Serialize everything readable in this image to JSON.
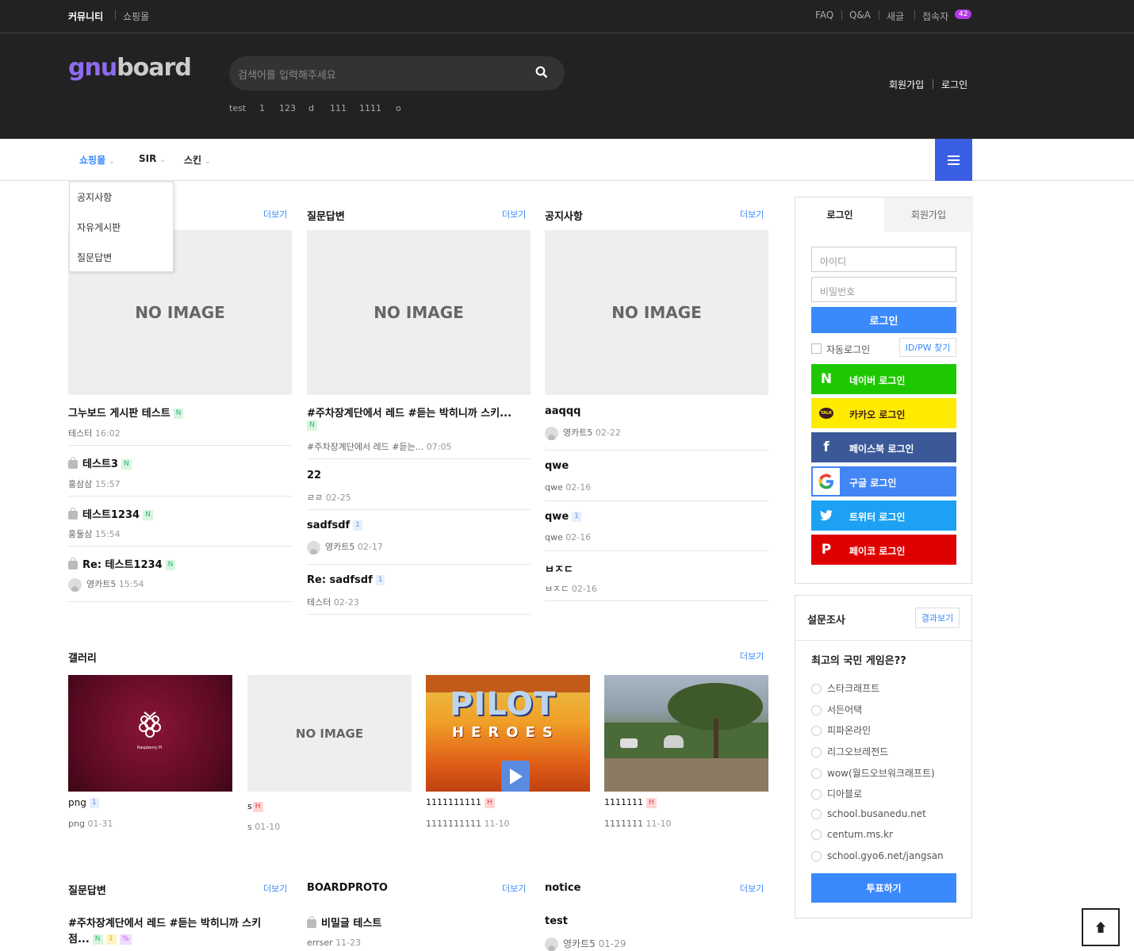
{
  "topbar": {
    "community": "커뮤니티",
    "shop": "쇼핑몰",
    "faq": "FAQ",
    "qa": "Q&A",
    "new_posts": "새글",
    "visitors": "접속자",
    "visitor_count": "42"
  },
  "header": {
    "logo_a": "gnu",
    "logo_b": "board",
    "search_placeholder": "검색어를 입력해주세요",
    "popular": [
      "test",
      "1",
      "123",
      "d",
      "111",
      "1111",
      "o"
    ],
    "join": "회원가입",
    "login": "로그인"
  },
  "nav": {
    "items": [
      "쇼핑몰",
      "SIR",
      "스킨"
    ],
    "dropdown": [
      "공지사항",
      "자유게시판",
      "질문답변"
    ]
  },
  "more": "더보기",
  "col1": {
    "image": "NO IMAGE",
    "posts": [
      {
        "title": "그누보드 게시판 테스트",
        "author": "테스터",
        "date": "16:02"
      },
      {
        "title": "테스트3",
        "author": "홍삼삼",
        "date": "15:57"
      },
      {
        "title": "테스트1234",
        "author": "홍둘삼",
        "date": "15:54"
      },
      {
        "title": "Re: 테스트1234",
        "author": "영카트5",
        "date": "15:54"
      }
    ]
  },
  "col2": {
    "title": "질문답변",
    "image": "NO IMAGE",
    "posts": [
      {
        "title": "#주차장계단에서 레드 #듣는 박히니까 스키...",
        "author": "#주차장계단에서 레드 #듣는...",
        "date": "07:05"
      },
      {
        "title": "22",
        "author": "ㄹㄹ",
        "date": "02-25"
      },
      {
        "title": "sadfsdf",
        "comments": "1",
        "author": "영카트5",
        "date": "02-17"
      },
      {
        "title": "Re: sadfsdf",
        "comments": "1",
        "author": "테스터",
        "date": "02-23"
      }
    ]
  },
  "col3": {
    "title": "공지사항",
    "image": "NO IMAGE",
    "posts": [
      {
        "title": "aaqqq",
        "author": "영카트5",
        "date": "02-22"
      },
      {
        "title": "qwe",
        "author": "qwe",
        "date": "02-16"
      },
      {
        "title": "qwe",
        "comments": "1",
        "author": "qwe",
        "date": "02-16"
      },
      {
        "title": "ㅂㅈㄷ",
        "author": "ㅂㅈㄷ",
        "date": "02-16"
      }
    ]
  },
  "gallery": {
    "title": "갤러리",
    "items": [
      {
        "title": "png",
        "comments": "1",
        "author": "png",
        "date": "01-31",
        "caption": "Raspberry Pi"
      },
      {
        "title": "s",
        "badge": "H",
        "author": "s",
        "date": "01-10",
        "image": "NO IMAGE"
      },
      {
        "title": "1111111111",
        "badge": "H",
        "author": "1111111111",
        "date": "11-10",
        "caption_a": "PILOT",
        "caption_b": "HEROES"
      },
      {
        "title": "1111111",
        "badge": "H",
        "author": "1111111",
        "date": "11-10"
      }
    ]
  },
  "bottom": {
    "qa": {
      "title": "질문답변",
      "post": "#주차장계단에서 레드 #듣는 박히니까 스키",
      "post2": "점..."
    },
    "boardproto": {
      "title": "BOARDPROTO",
      "post": "비밀글 테스트",
      "author": "errser",
      "date": "11-23"
    },
    "notice": {
      "title": "notice",
      "post": "test",
      "author": "영카트5",
      "date": "01-29"
    }
  },
  "login": {
    "tab_login": "로그인",
    "tab_join": "회원가입",
    "id_ph": "아이디",
    "pw_ph": "비밀번호",
    "submit": "로그인",
    "auto": "자동로그인",
    "find": "ID/PW 찾기",
    "social": [
      {
        "label": "네이버 로그인",
        "color": "#1ec800",
        "icon": "N"
      },
      {
        "label": "카카오 로그인",
        "color": "#ffeb00",
        "icon": "TALK"
      },
      {
        "label": "페이스북 로그인",
        "color": "#3b5998",
        "icon": "f"
      },
      {
        "label": "구글 로그인",
        "color": "#4285f4",
        "icon": "G"
      },
      {
        "label": "트위터 로그인",
        "color": "#1da1f2",
        "icon": "t"
      },
      {
        "label": "페이코 로그인",
        "color": "#df0000",
        "icon": "P"
      }
    ]
  },
  "poll": {
    "title": "설문조사",
    "result": "결과보기",
    "question": "최고의 국민 게임은??",
    "options": [
      "스타크래프트",
      "서든어택",
      "피파온라인",
      "리그오브레전드",
      "wow(월드오브워크래프트)",
      "디아블로",
      "school.busanedu.net",
      "centum.ms.kr",
      "school.gyo6.net/jangsan"
    ],
    "vote": "투표하기"
  },
  "colors": {
    "accent": "#3a8afd",
    "hamburger": "#3a5fe5",
    "header_bg": "#222222"
  }
}
